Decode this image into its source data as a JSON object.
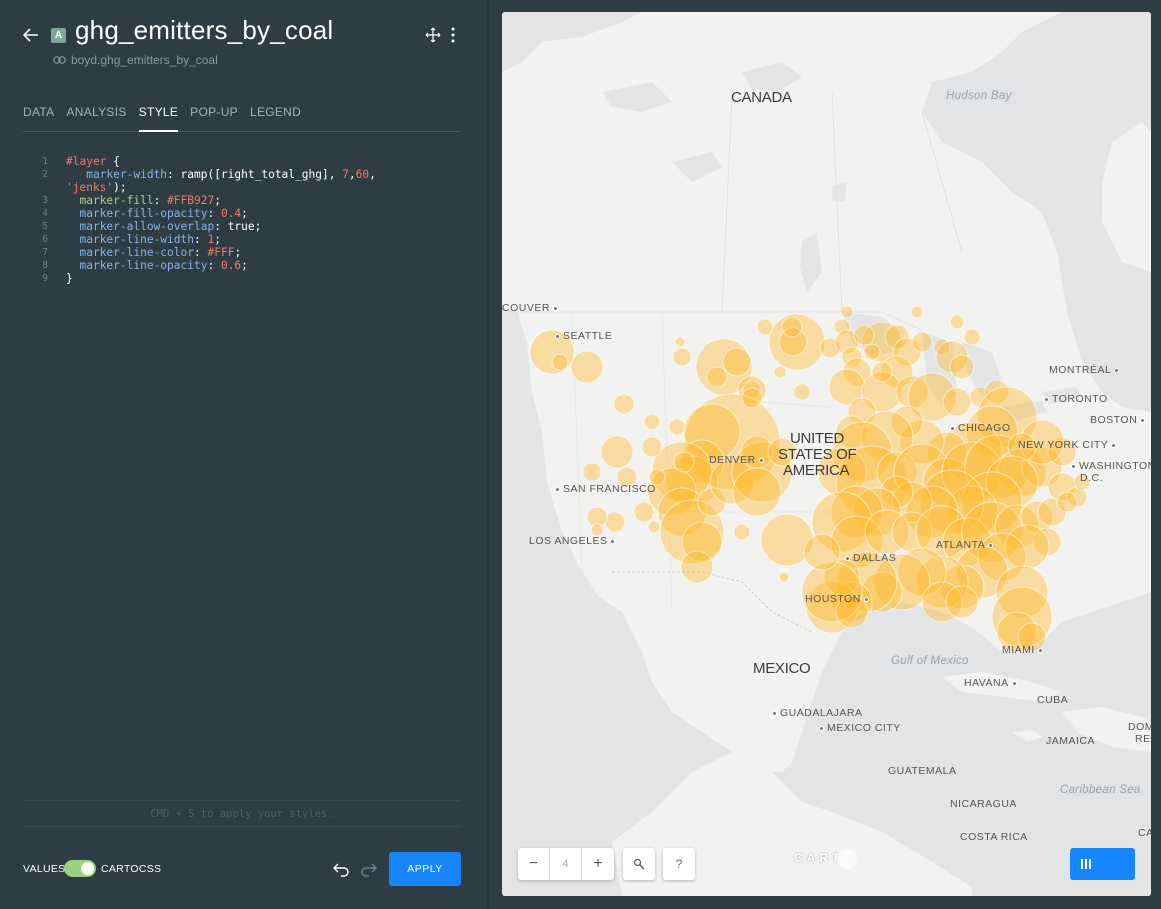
{
  "header": {
    "layer_letter": "A",
    "title": "ghg_emitters_by_coal",
    "dataset": "boyd.ghg_emitters_by_coal"
  },
  "tabs": [
    {
      "label": "DATA",
      "active": false
    },
    {
      "label": "ANALYSIS",
      "active": false
    },
    {
      "label": "STYLE",
      "active": true
    },
    {
      "label": "POP-UP",
      "active": false
    },
    {
      "label": "LEGEND",
      "active": false
    }
  ],
  "code": {
    "line_numbers": [
      "1",
      "2",
      "3",
      "4",
      "5",
      "6",
      "7",
      "8",
      "9"
    ],
    "l1_selector": "#layer",
    "l1_brace": " {",
    "l2_prop": "marker-width",
    "l2_colon": ": ramp([right_total_ghg], ",
    "l2_n1": "7",
    "l2_comma": ",",
    "l2_n2": "60",
    "l2_end": ",",
    "l2b_str": "'jenks'",
    "l2b_end": ");",
    "l3_prop": "marker-fill",
    "l3_val": "#FFB927",
    "l4_prop": "marker-fill-opacity",
    "l4_val": "0.4",
    "l5_prop": "marker-allow-overlap",
    "l5_val": "true",
    "l6_prop": "marker-line-width",
    "l6_val": "1",
    "l7_prop": "marker-line-color",
    "l7_val": "#FFF",
    "l8_prop": "marker-line-opacity",
    "l8_val": "0.6",
    "l9_brace": "}"
  },
  "hint": "CMD + S to apply your styles.",
  "footer": {
    "values_label": "VALUES",
    "cartocss_label": "CARTOCSS",
    "toggle_on": true,
    "apply_label": "APPLY"
  },
  "map": {
    "zoom_level": "4",
    "zoom_out": "−",
    "zoom_in": "+",
    "help": "?",
    "logo": "CART",
    "marker_color": "#FFB927",
    "countries": {
      "canada": "CANADA",
      "usa1": "UNITED",
      "usa2": "STATES OF",
      "usa3": "AMERICA",
      "mexico": "MEXICO"
    },
    "water": {
      "hudson": "Hudson Bay",
      "gulf": "Gulf of Mexico",
      "caribbean": "Caribbean Sea"
    },
    "cities": {
      "couver": "COUVER",
      "seattle": "SEATTLE",
      "montreal": "MONTRÉAL",
      "toronto": "TORONTO",
      "boston": "BOSTON",
      "chicago": "CHICAGO",
      "new_york": "NEW YORK CITY",
      "washington1": "WASHINGTON",
      "washington2": "D.C.",
      "denver": "DENVER",
      "san_francisco": "SAN FRANCISCO",
      "los_angeles": "LOS ANGELES",
      "dallas": "DALLAS",
      "atlanta": "ATLANTA",
      "houston": "HOUSTON",
      "miami": "MIAMI",
      "havana": "HAVANA",
      "cuba": "CUBA",
      "guadalajara": "GUADALAJARA",
      "mexico_city": "MEXICO CITY",
      "guatemala": "GUATEMALA",
      "domin1": "DOMIN",
      "domin2": "REPU",
      "jamaica": "JAMAICA",
      "nicaragua": "NICARAGUA",
      "costa_rica": "COSTA RICA",
      "ca": "CA"
    }
  }
}
